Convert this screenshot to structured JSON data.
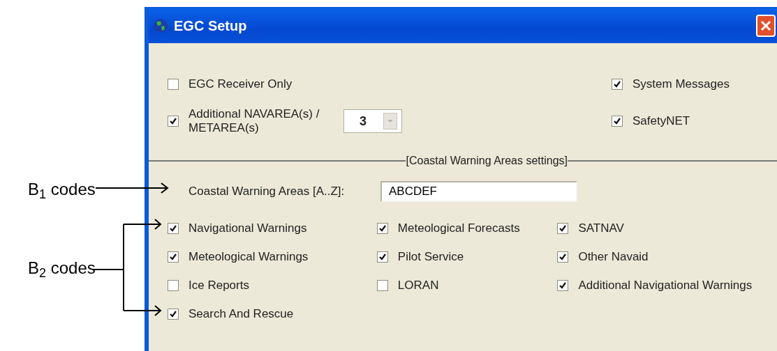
{
  "window": {
    "title": "EGC Setup"
  },
  "left_options": [
    {
      "label": "EGC Receiver Only",
      "checked": false
    },
    {
      "label": "Additional NAVAREA(s) / METAREA(s)",
      "checked": true
    }
  ],
  "navarea_count": {
    "value": "3"
  },
  "right_options": [
    {
      "label": "System Messages",
      "checked": true
    },
    {
      "label": "SafetyNET",
      "checked": true
    }
  ],
  "section_title": "[Coastal Warning Areas settings]",
  "coastal_field": {
    "label": "Coastal Warning Areas [A..Z]:",
    "value": "ABCDEF"
  },
  "b2_columns": [
    [
      {
        "label": "Navigational Warnings",
        "checked": true
      },
      {
        "label": "Meteological Warnings",
        "checked": true
      },
      {
        "label": "Ice Reports",
        "checked": false
      },
      {
        "label": "Search And Rescue",
        "checked": true
      }
    ],
    [
      {
        "label": "Meteological Forecasts",
        "checked": true
      },
      {
        "label": "Pilot Service",
        "checked": true
      },
      {
        "label": "LORAN",
        "checked": false
      }
    ],
    [
      {
        "label": "SATNAV",
        "checked": true
      },
      {
        "label": "Other Navaid",
        "checked": true
      },
      {
        "label": "Additional Navigational Warnings",
        "checked": true
      }
    ]
  ],
  "annotations": [
    {
      "label": "B$_{1}$ codes"
    },
    {
      "label": "B$_{2}$ codes"
    }
  ]
}
